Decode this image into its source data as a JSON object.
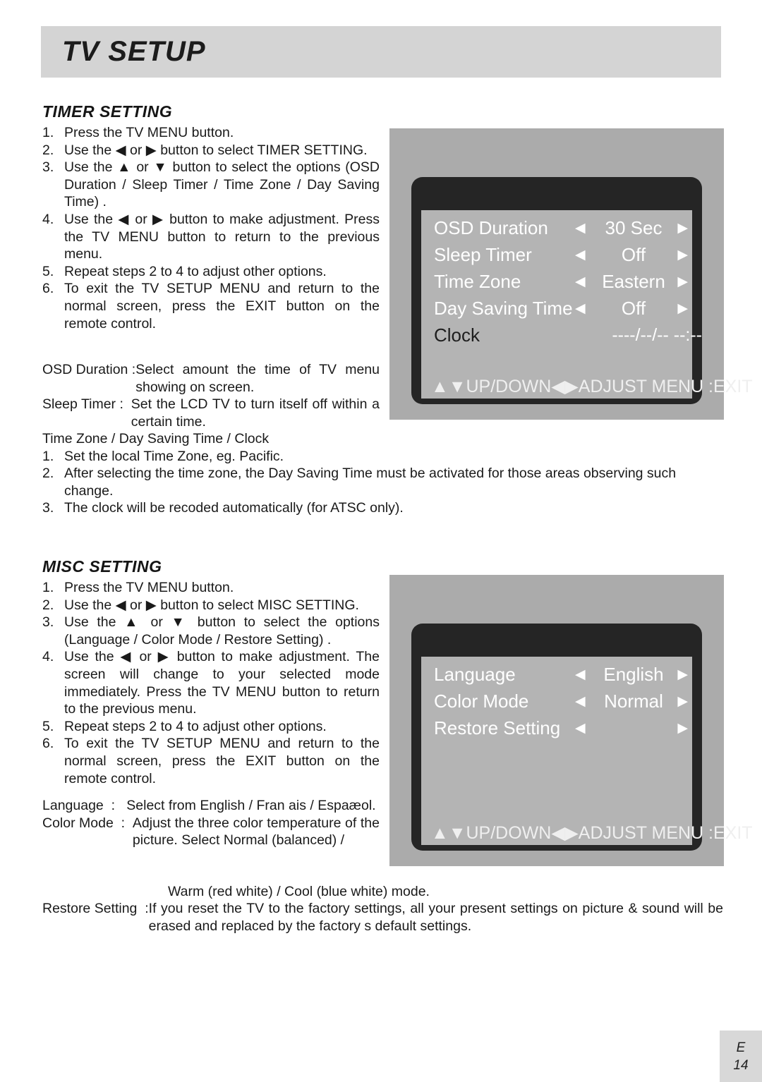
{
  "header": {
    "title": "TV SETUP"
  },
  "timer_section": {
    "heading": "TIMER SETTING",
    "steps": [
      {
        "num": "1.",
        "text": "Press the TV MENU button."
      },
      {
        "num": "2.",
        "text": "Use the ◀ or ▶ button to select TIMER SETTING."
      },
      {
        "num": "3.",
        "text": "Use the ▲ or ▼ button to select the options (OSD Duration / Sleep Timer / Time Zone / Day Saving Time) ."
      },
      {
        "num": "4.",
        "text": "Use the ◀ or ▶ button to make adjustment. Press the TV MENU button to return to the previous menu."
      },
      {
        "num": "5.",
        "text": "Repeat steps 2 to 4 to adjust other options."
      },
      {
        "num": "6.",
        "text": "To exit the TV SETUP MENU and return to the normal screen, press the EXIT button on the remote control."
      }
    ],
    "definitions": [
      {
        "label": "OSD Duration :",
        "desc": "Select amount the time of TV menu showing on screen."
      },
      {
        "label": "Sleep Timer :  ",
        "desc": "Set the LCD TV to turn itself off within a certain time."
      }
    ],
    "timezone_heading": "Time Zone / Day Saving Time / Clock",
    "timezone_steps": [
      {
        "num": "1.",
        "text": "Set the local Time Zone, eg. Pacific."
      },
      {
        "num": "2.",
        "text": "After selecting the time zone, the Day Saving Time must be activated for those areas observing such change."
      },
      {
        "num": "3.",
        "text": "The clock will be recoded automatically (for ATSC only)."
      }
    ]
  },
  "timer_osd": {
    "rows": [
      {
        "label": "OSD Duration",
        "left_arrow": "◀",
        "value": "30 Sec",
        "right_arrow": "▶"
      },
      {
        "label": "Sleep Timer",
        "left_arrow": "◀",
        "value": "Off",
        "right_arrow": "▶"
      },
      {
        "label": "Time Zone",
        "left_arrow": "◀",
        "value": "Eastern",
        "right_arrow": "▶"
      },
      {
        "label": "Day Saving Time",
        "left_arrow": "◀",
        "value": "Off",
        "right_arrow": "▶"
      }
    ],
    "clock_label": "Clock",
    "clock_value": "----/--/--  --:--",
    "status": "▲▼UP/DOWN◀▶ADJUST  MENU :EXIT"
  },
  "misc_section": {
    "heading": "MISC SETTING",
    "steps": [
      {
        "num": "1.",
        "text": "Press the TV MENU button."
      },
      {
        "num": "2.",
        "text": "Use the ◀ or ▶ button to select MISC SETTING."
      },
      {
        "num": "3.",
        "text": "Use the ▲ or ▼ button to select the options (Language / Color Mode / Restore Setting)   ."
      },
      {
        "num": "4.",
        "text": "Use the ◀ or ▶ button to make adjustment. The screen will change to your selected mode immediately. Press the TV MENU button to return to the previous menu."
      },
      {
        "num": "5.",
        "text": "Repeat steps 2 to 4 to adjust other options."
      },
      {
        "num": "6.",
        "text": "To exit the TV SETUP MENU and return to the normal screen, press the EXIT button on the remote control."
      }
    ],
    "definitions": [
      {
        "label": "Language  :   ",
        "desc": "Select from English / Fran ais / Espaæol."
      },
      {
        "label": "Color Mode  :  ",
        "desc": "Adjust the three color temperature of the picture. Select Normal (balanced) /"
      }
    ],
    "colormode_extra": "Warm (red white) / Cool (blue white) mode.",
    "restore": {
      "label": "Restore Setting  :",
      "desc": "If you reset the TV to the factory settings, all your present settings on picture & sound will be erased and replaced by the factory s default settings."
    }
  },
  "misc_osd": {
    "rows": [
      {
        "label": "Language",
        "left_arrow": "◀",
        "value": "English",
        "right_arrow": "▶"
      },
      {
        "label": "Color Mode",
        "left_arrow": "◀",
        "value": "Normal",
        "right_arrow": "▶"
      },
      {
        "label": "Restore Setting",
        "left_arrow": "◀",
        "value": "",
        "right_arrow": "▶"
      }
    ],
    "status": "▲▼UP/DOWN◀▶ADJUST  MENU :EXIT"
  },
  "footer": {
    "lang_code": "E",
    "page_number": "14"
  }
}
